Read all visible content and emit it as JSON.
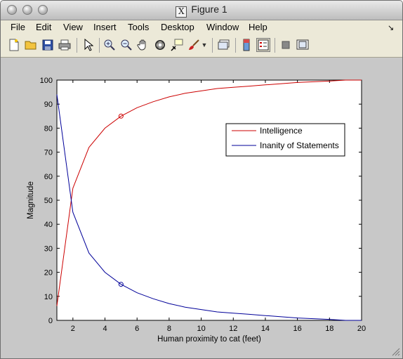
{
  "window": {
    "title": "Figure 1"
  },
  "menu": {
    "file": "File",
    "edit": "Edit",
    "view": "View",
    "insert": "Insert",
    "tools": "Tools",
    "desktop": "Desktop",
    "window": "Window",
    "help": "Help"
  },
  "toolbar": {
    "icons": [
      "new-figure-icon",
      "open-file-icon",
      "save-icon",
      "print-icon",
      "pointer-icon",
      "zoom-in-icon",
      "zoom-out-icon",
      "pan-icon",
      "rotate-3d-icon",
      "data-cursor-icon",
      "brush-icon",
      "dropdown-arrow-icon",
      "link-plot-icon",
      "colorbar-icon",
      "legend-icon",
      "hide-plot-tools-icon",
      "show-plot-tools-icon"
    ]
  },
  "chart_data": {
    "type": "line",
    "title": "",
    "xlabel": "Human proximity to cat (feet)",
    "ylabel": "Magnitude",
    "xlim": [
      1,
      20
    ],
    "ylim": [
      0,
      100
    ],
    "xticks": [
      2,
      4,
      6,
      8,
      10,
      12,
      14,
      16,
      18,
      20
    ],
    "yticks": [
      0,
      10,
      20,
      30,
      40,
      50,
      60,
      70,
      80,
      90,
      100
    ],
    "grid": false,
    "legend_position": "top-right",
    "series": [
      {
        "name": "Intelligence",
        "color": "#cc0000",
        "x": [
          1,
          2,
          3,
          4,
          5,
          6,
          7,
          8,
          9,
          10,
          11,
          12,
          13,
          14,
          15,
          16,
          17,
          18,
          19,
          20
        ],
        "y": [
          6,
          55,
          72,
          80,
          85,
          88.5,
          91,
          93,
          94.5,
          95.5,
          96.5,
          97,
          97.5,
          98,
          98.5,
          99,
          99.3,
          99.6,
          100,
          100
        ]
      },
      {
        "name": "Inanity of Statements",
        "color": "#000099",
        "x": [
          1,
          2,
          3,
          4,
          5,
          6,
          7,
          8,
          9,
          10,
          11,
          12,
          13,
          14,
          15,
          16,
          17,
          18,
          19,
          20
        ],
        "y": [
          94,
          45,
          28,
          20,
          15,
          11.5,
          9,
          7,
          5.5,
          4.5,
          3.5,
          3,
          2.5,
          2,
          1.5,
          1,
          0.7,
          0.4,
          0,
          0
        ]
      }
    ],
    "markers": [
      {
        "x": 5,
        "y": 85,
        "color": "#cc0000"
      },
      {
        "x": 5,
        "y": 15,
        "color": "#000099"
      }
    ]
  }
}
